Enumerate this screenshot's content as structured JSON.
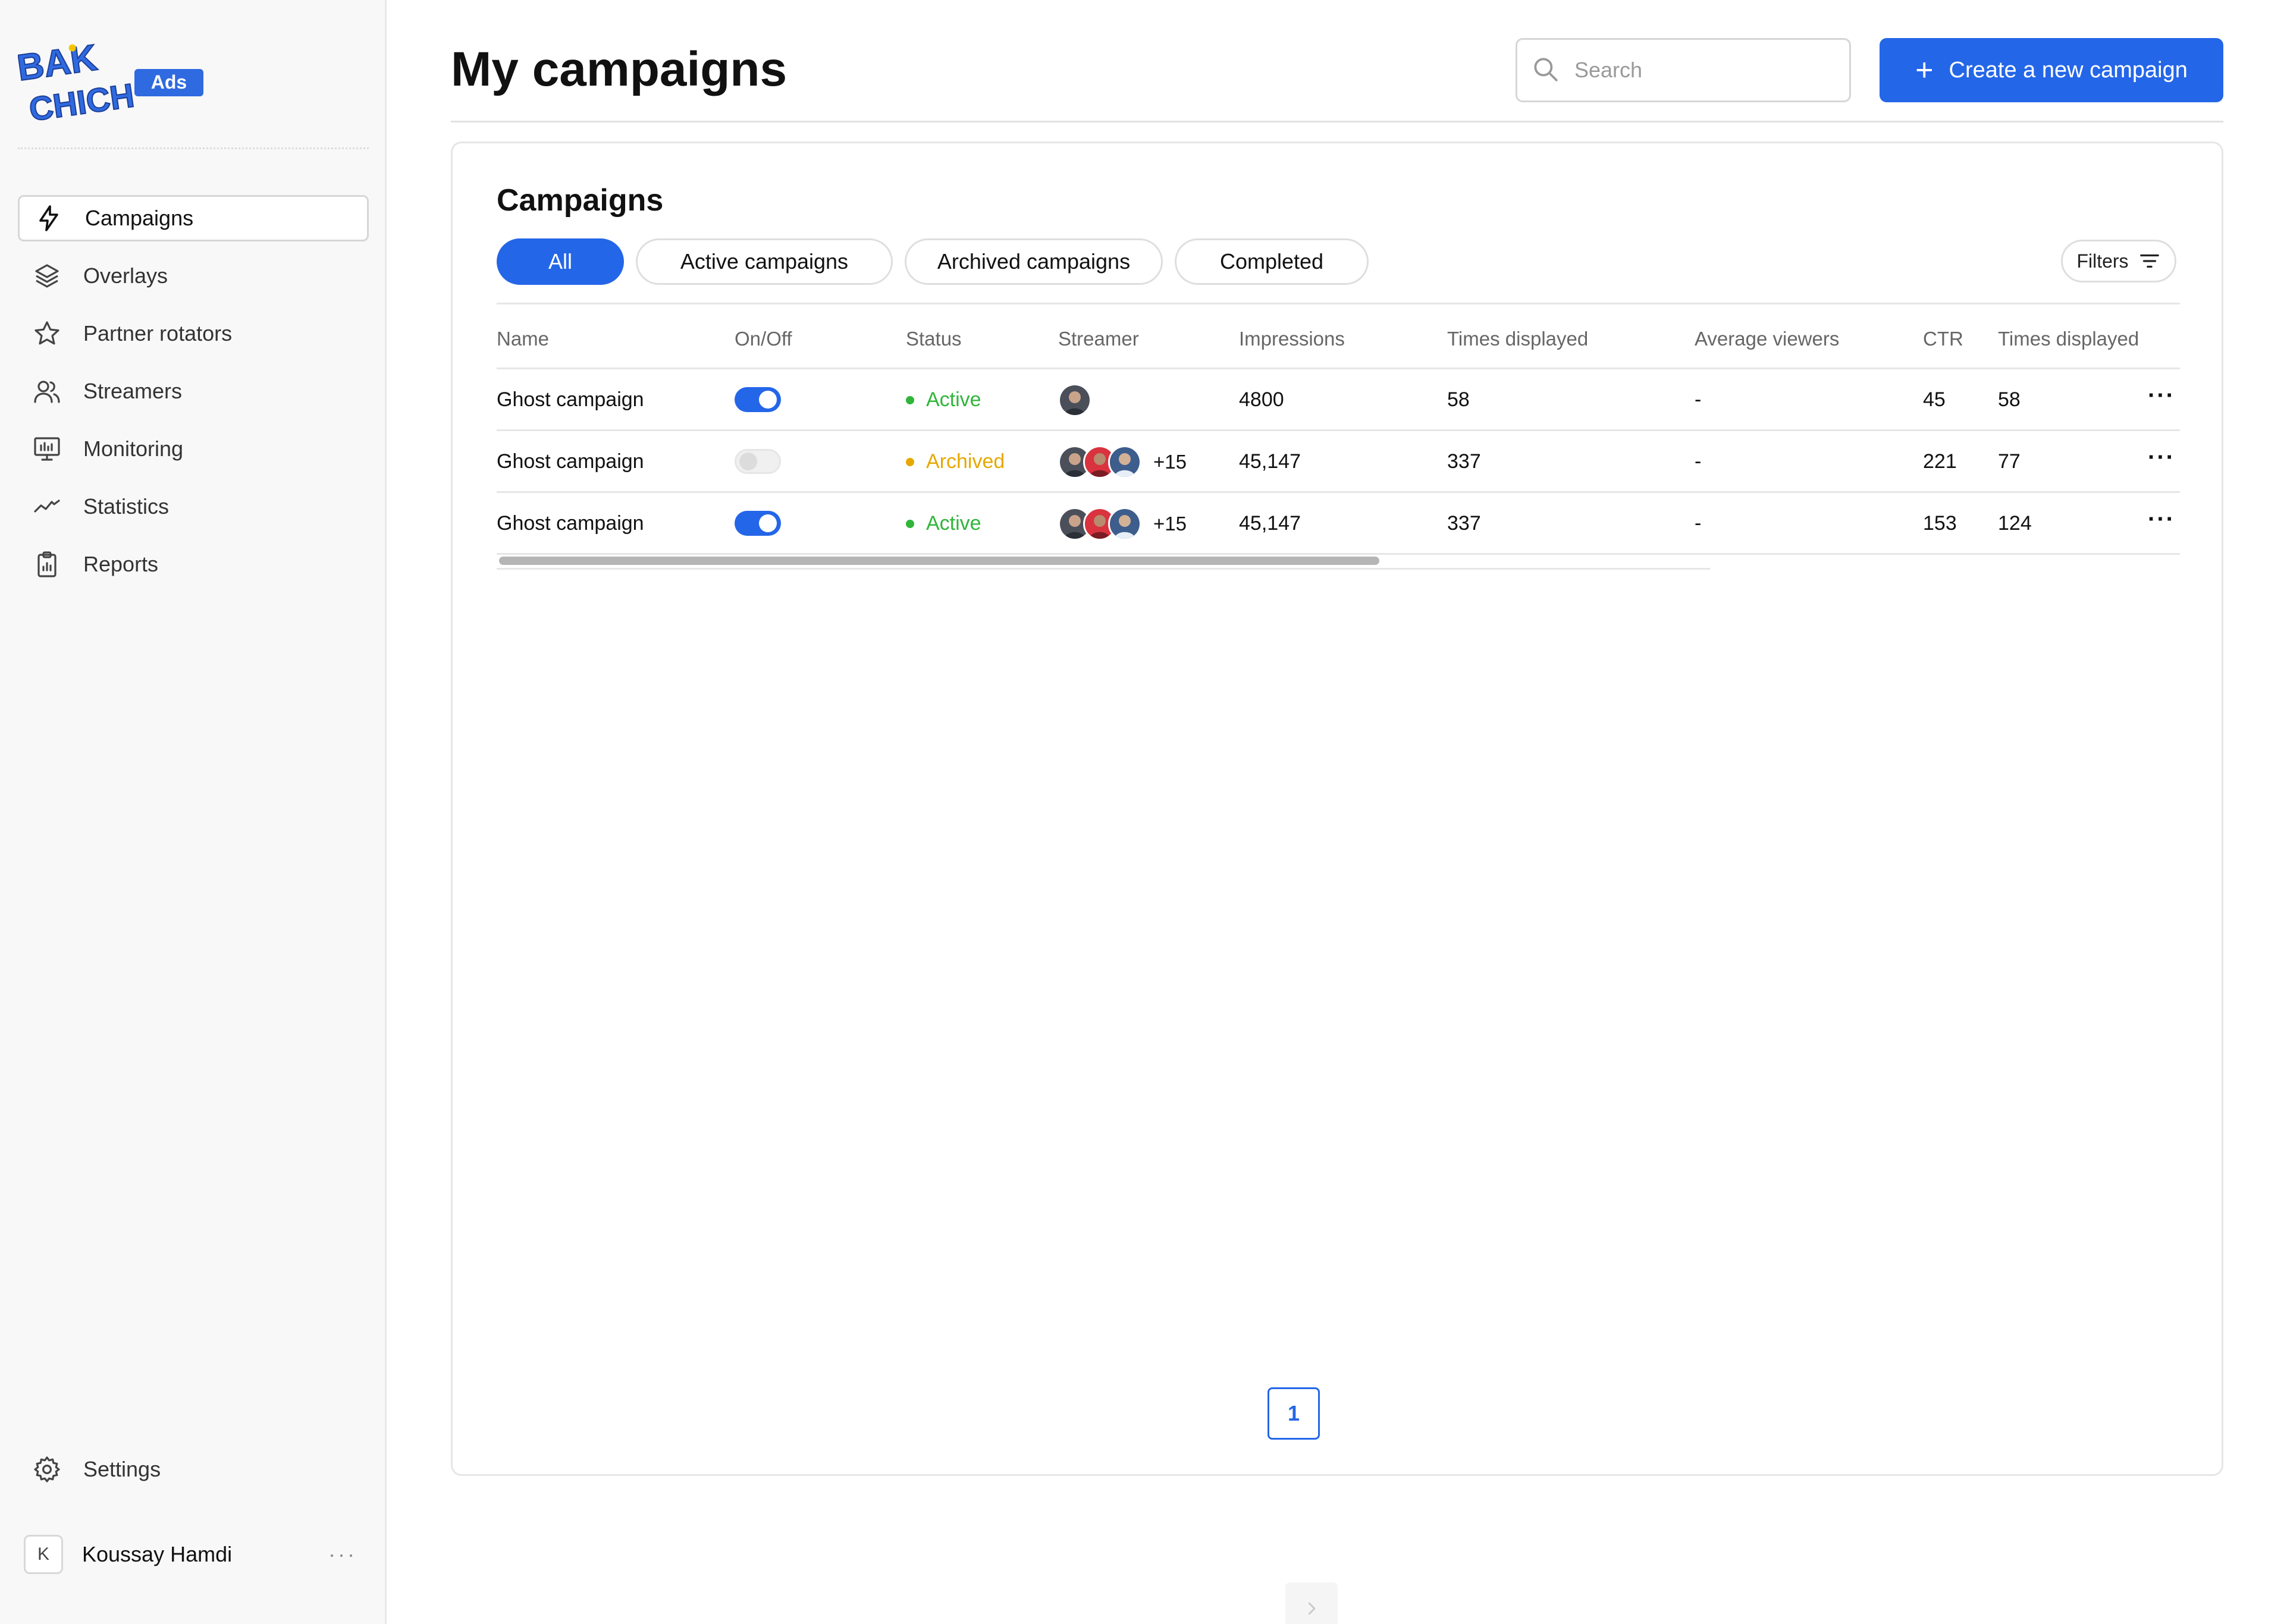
{
  "brand": {
    "logo_line1": "BAK",
    "logo_line2": "CHICH",
    "badge": "Ads",
    "accent_color": "#2466e8"
  },
  "sidebar": {
    "items": [
      {
        "label": "Campaigns",
        "icon": "lightning-icon",
        "active": true
      },
      {
        "label": "Overlays",
        "icon": "layers-icon",
        "active": false
      },
      {
        "label": "Partner rotators",
        "icon": "star-icon",
        "active": false
      },
      {
        "label": "Streamers",
        "icon": "users-icon",
        "active": false
      },
      {
        "label": "Monitoring",
        "icon": "monitor-icon",
        "active": false
      },
      {
        "label": "Statistics",
        "icon": "trend-line-icon",
        "active": false
      },
      {
        "label": "Reports",
        "icon": "clipboard-icon",
        "active": false
      }
    ],
    "settings_label": "Settings",
    "user": {
      "initial": "K",
      "name": "Koussay Hamdi",
      "more": "···"
    }
  },
  "header": {
    "title": "My campaigns",
    "search_placeholder": "Search",
    "create_label": "Create a new campaign"
  },
  "campaigns": {
    "title": "Campaigns",
    "tabs": [
      {
        "label": "All",
        "active": true
      },
      {
        "label": "Active campaigns",
        "active": false
      },
      {
        "label": "Archived campaigns",
        "active": false
      },
      {
        "label": "Completed",
        "active": false
      }
    ],
    "filters_label": "Filters",
    "columns": [
      "Name",
      "On/Off",
      "Status",
      "Streamer",
      "Impressions",
      "Times displayed",
      "Average viewers",
      "CTR",
      "Times displayed"
    ],
    "rows": [
      {
        "name": "Ghost campaign",
        "on": true,
        "status": "Active",
        "streamer_count": 1,
        "more_streamers": "",
        "impressions": "4800",
        "times_displayed": "58",
        "average_viewers": "-",
        "ctr": "45",
        "times_displayed_2": "58"
      },
      {
        "name": "Ghost campaign",
        "on": false,
        "status": "Archived",
        "streamer_count": 3,
        "more_streamers": "+15",
        "impressions": "45,147",
        "times_displayed": "337",
        "average_viewers": "-",
        "ctr": "221",
        "times_displayed_2": "77"
      },
      {
        "name": "Ghost campaign",
        "on": true,
        "status": "Active",
        "streamer_count": 3,
        "more_streamers": "+15",
        "impressions": "45,147",
        "times_displayed": "337",
        "average_viewers": "-",
        "ctr": "153",
        "times_displayed_2": "124"
      }
    ],
    "status_colors": {
      "Active": "#2fb53a",
      "Archived": "#e6a800"
    }
  },
  "pagination": {
    "current_page": "1"
  }
}
